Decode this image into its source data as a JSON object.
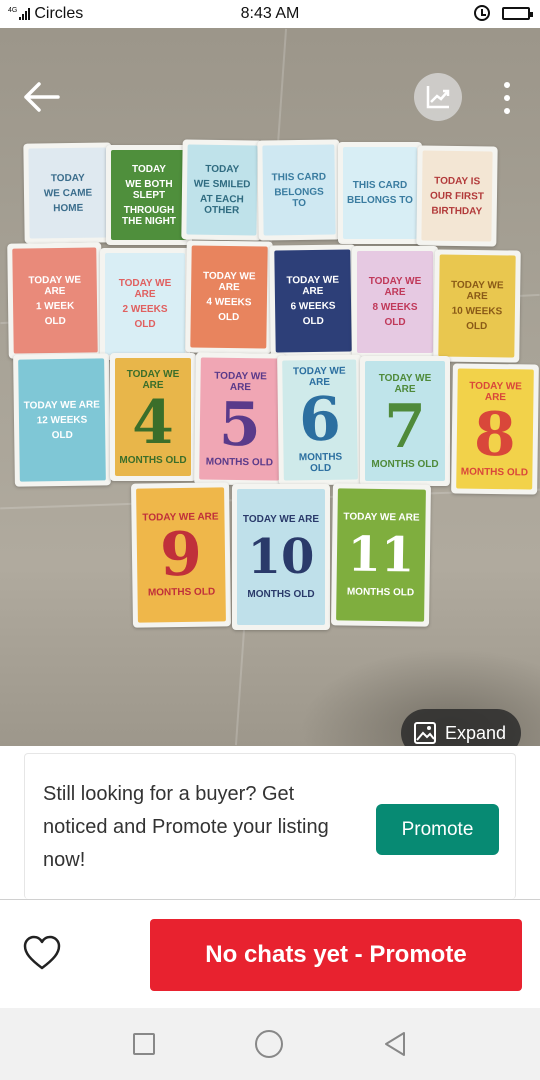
{
  "status_bar": {
    "network": "4G",
    "carrier": "Circles",
    "time": "8:43 AM"
  },
  "photo": {
    "cards": [
      {
        "lines": [
          "TODAY",
          "WE CAME",
          "HOME"
        ],
        "bg": "#dfe9f0",
        "fg": "#3b6d8c"
      },
      {
        "lines": [
          "TODAY",
          "WE BOTH SLEPT",
          "THROUGH THE NIGHT"
        ],
        "bg": "#4f8f3c",
        "fg": "#ffffff"
      },
      {
        "lines": [
          "TODAY",
          "WE SMILED",
          "AT EACH OTHER"
        ],
        "bg": "#bfe2ea",
        "fg": "#2f6b80"
      },
      {
        "lines": [
          "THIS CARD",
          "BELONGS TO"
        ],
        "bg": "#cfe8f2",
        "fg": "#3a7ca0"
      },
      {
        "lines": [
          "THIS CARD",
          "BELONGS TO"
        ],
        "bg": "#d8eef5",
        "fg": "#3a7ca0"
      },
      {
        "lines": [
          "TODAY IS",
          "OUR FIRST",
          "BIRTHDAY"
        ],
        "bg": "#f3e6d4",
        "fg": "#b23a3a"
      },
      {
        "lines": [
          "TODAY WE ARE",
          "1 WEEK",
          "OLD"
        ],
        "bg": "#e98a7a",
        "fg": "#ffffff"
      },
      {
        "lines": [
          "TODAY WE ARE",
          "2 WEEKS",
          "OLD"
        ],
        "bg": "#d9eef5",
        "fg": "#e06060"
      },
      {
        "lines": [
          "TODAY WE ARE",
          "4 WEEKS",
          "OLD"
        ],
        "bg": "#e8845e",
        "fg": "#ffffff"
      },
      {
        "lines": [
          "TODAY WE ARE",
          "6 WEEKS",
          "OLD"
        ],
        "bg": "#2d3f78",
        "fg": "#ffffff"
      },
      {
        "lines": [
          "TODAY WE ARE",
          "8 WEEKS",
          "OLD"
        ],
        "bg": "#e6c9e2",
        "fg": "#c0395a"
      },
      {
        "lines": [
          "TODAY WE ARE",
          "10 WEEKS",
          "OLD"
        ],
        "bg": "#e9c74f",
        "fg": "#8a5a17"
      },
      {
        "lines": [
          "TODAY WE ARE",
          "12 WEEKS",
          "OLD"
        ],
        "bg": "#7fc7d6",
        "fg": "#ffffff"
      },
      {
        "lines": [
          "TODAY WE ARE",
          "4",
          "MONTHS OLD"
        ],
        "bg": "#e8b64a",
        "fg": "#3b6e2a"
      },
      {
        "lines": [
          "TODAY WE ARE",
          "5",
          "MONTHS OLD"
        ],
        "bg": "#f0a6b4",
        "fg": "#5a3a8a"
      },
      {
        "lines": [
          "TODAY WE ARE",
          "6",
          "MONTHS OLD"
        ],
        "bg": "#cfeaea",
        "fg": "#2c6fa0"
      },
      {
        "lines": [
          "TODAY WE ARE",
          "7",
          "MONTHS OLD"
        ],
        "bg": "#bfe4ea",
        "fg": "#4f8a3a"
      },
      {
        "lines": [
          "TODAY WE ARE",
          "8",
          "MONTHS OLD"
        ],
        "bg": "#f2d24a",
        "fg": "#d9473a"
      },
      {
        "lines": [
          "TODAY WE ARE",
          "9",
          "MONTHS OLD"
        ],
        "bg": "#efb74a",
        "fg": "#c0303a"
      },
      {
        "lines": [
          "TODAY WE ARE",
          "10",
          "MONTHS OLD"
        ],
        "bg": "#bfe0ea",
        "fg": "#2a3a6a"
      },
      {
        "lines": [
          "TODAY WE ARE",
          "11",
          "MONTHS OLD"
        ],
        "bg": "#7fae3e",
        "fg": "#ffffff"
      }
    ],
    "expand_label": "Expand"
  },
  "icons": {
    "back": "arrow-left-icon",
    "stats": "trending-chart-icon",
    "more": "more-vertical-icon",
    "expand": "image-icon",
    "favorite": "heart-icon"
  },
  "promo": {
    "text": "Still looking for a buyer? Get noticed and Promote your listing now!",
    "button_label": "Promote"
  },
  "action_bar": {
    "chat_button_label": "No chats yet - Promote"
  },
  "colors": {
    "promote_green": "#078a73",
    "chat_red": "#e8222f"
  }
}
